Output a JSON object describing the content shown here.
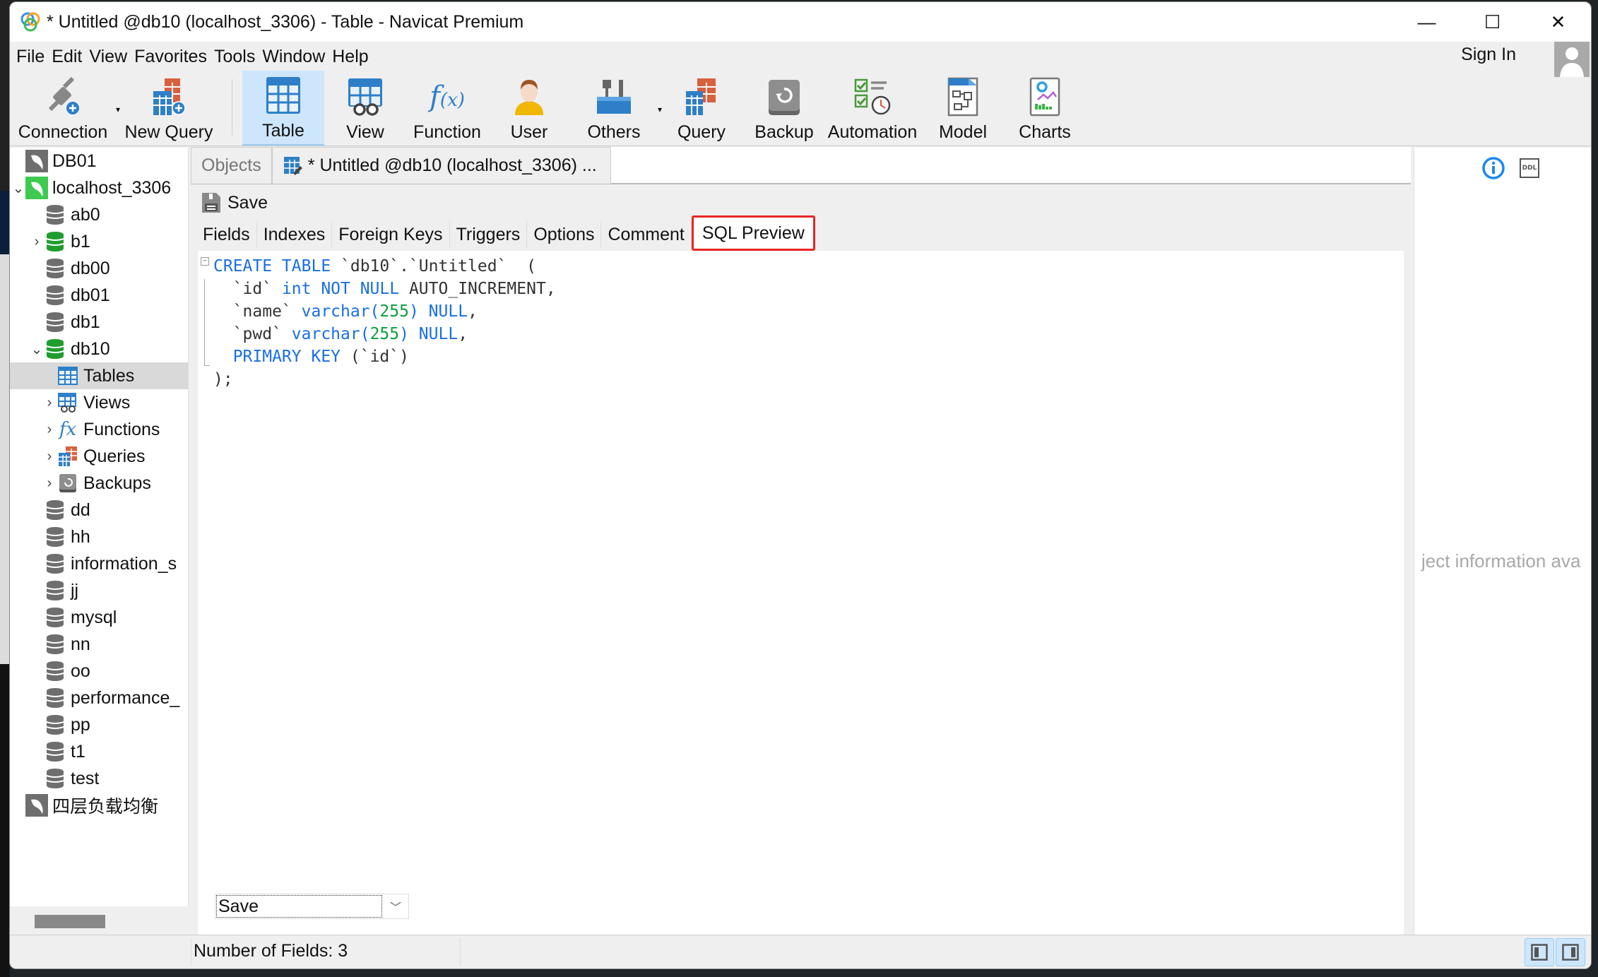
{
  "window": {
    "title": "* Untitled @db10 (localhost_3306) - Table - Navicat Premium",
    "minimize": "—",
    "maximize": "☐",
    "close": "✕"
  },
  "menu": [
    "File",
    "Edit",
    "View",
    "Favorites",
    "Tools",
    "Window",
    "Help"
  ],
  "account": {
    "sign_in": "Sign In"
  },
  "toolbar": [
    {
      "label": "Connection",
      "icon": "connection-icon",
      "dropdown": true
    },
    {
      "label": "New Query",
      "icon": "new-query-icon",
      "dropdown": false
    },
    {
      "label": "Table",
      "icon": "table-icon",
      "active": true
    },
    {
      "label": "View",
      "icon": "view-icon"
    },
    {
      "label": "Function",
      "icon": "function-icon"
    },
    {
      "label": "User",
      "icon": "user-icon"
    },
    {
      "label": "Others",
      "icon": "others-icon",
      "dropdown": true
    },
    {
      "label": "Query",
      "icon": "query-icon"
    },
    {
      "label": "Backup",
      "icon": "backup-icon"
    },
    {
      "label": "Automation",
      "icon": "automation-icon"
    },
    {
      "label": "Model",
      "icon": "model-icon"
    },
    {
      "label": "Charts",
      "icon": "charts-icon"
    }
  ],
  "tree": [
    {
      "label": "DB01",
      "type": "connection",
      "status": "inactive"
    },
    {
      "label": "localhost_3306",
      "type": "connection",
      "status": "active",
      "expanded": true
    },
    {
      "label": "ab0",
      "type": "database"
    },
    {
      "label": "b1",
      "type": "database",
      "open": true,
      "collapsed": true
    },
    {
      "label": "db00",
      "type": "database"
    },
    {
      "label": "db01",
      "type": "database"
    },
    {
      "label": "db1",
      "type": "database"
    },
    {
      "label": "db10",
      "type": "database",
      "open": true,
      "expanded": true
    },
    {
      "label": "Tables",
      "type": "tables",
      "selected": true
    },
    {
      "label": "Views",
      "type": "views"
    },
    {
      "label": "Functions",
      "type": "functions"
    },
    {
      "label": "Queries",
      "type": "queries"
    },
    {
      "label": "Backups",
      "type": "backups"
    },
    {
      "label": "dd",
      "type": "database"
    },
    {
      "label": "hh",
      "type": "database"
    },
    {
      "label": "information_s",
      "type": "database"
    },
    {
      "label": "jj",
      "type": "database"
    },
    {
      "label": "mysql",
      "type": "database"
    },
    {
      "label": "nn",
      "type": "database"
    },
    {
      "label": "oo",
      "type": "database"
    },
    {
      "label": "performance_",
      "type": "database"
    },
    {
      "label": "pp",
      "type": "database"
    },
    {
      "label": "t1",
      "type": "database"
    },
    {
      "label": "test",
      "type": "database"
    },
    {
      "label": "四层负载均衡",
      "type": "connection",
      "status": "inactive"
    }
  ],
  "doc_tabs": {
    "objects": "Objects",
    "current": "* Untitled @db10 (localhost_3306) ..."
  },
  "save_button": "Save",
  "sub_tabs": [
    "Fields",
    "Indexes",
    "Foreign Keys",
    "Triggers",
    "Options",
    "Comment",
    "SQL Preview"
  ],
  "active_sub_tab": "SQL Preview",
  "sql_preview": [
    [
      {
        "t": "CREATE TABLE ",
        "c": "kw"
      },
      {
        "t": "`db10`.`Untitled`  (",
        "c": "plain"
      }
    ],
    [
      {
        "t": "  `id` ",
        "c": "plain"
      },
      {
        "t": "int NOT NULL ",
        "c": "kw"
      },
      {
        "t": "AUTO_INCREMENT,",
        "c": "plain"
      }
    ],
    [
      {
        "t": "  `name` ",
        "c": "plain"
      },
      {
        "t": "varchar(",
        "c": "kw"
      },
      {
        "t": "255",
        "c": "num"
      },
      {
        "t": ") NULL",
        "c": "kw"
      },
      {
        "t": ",",
        "c": "plain"
      }
    ],
    [
      {
        "t": "  `pwd` ",
        "c": "plain"
      },
      {
        "t": "varchar(",
        "c": "kw"
      },
      {
        "t": "255",
        "c": "num"
      },
      {
        "t": ") NULL",
        "c": "kw"
      },
      {
        "t": ",",
        "c": "plain"
      }
    ],
    [
      {
        "t": "  PRIMARY KEY ",
        "c": "kw"
      },
      {
        "t": "(`id`)",
        "c": "plain"
      }
    ],
    [
      {
        "t": ");",
        "c": "plain"
      }
    ]
  ],
  "save_select": {
    "value": "Save"
  },
  "info_panel": {
    "message": "ject information ava",
    "ddl_label": "DDL"
  },
  "status": {
    "fields": "Number of Fields: 3"
  },
  "colors": {
    "accent": "#1a6fe0",
    "number": "#0aa03c",
    "highlight_box": "#e82626",
    "active_tool": "#cde6fb"
  }
}
